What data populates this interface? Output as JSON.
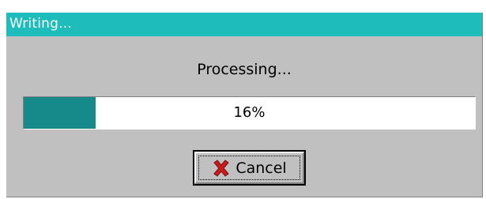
{
  "window": {
    "title": "Writing..."
  },
  "dialog": {
    "message": "Processing...",
    "progress": {
      "percent_label": "16%",
      "fraction": 0.16
    },
    "cancel_button": {
      "label": "Cancel",
      "icon": "red-x-icon"
    }
  },
  "colors": {
    "title_bar": "#1fbcbc",
    "dialog_bg": "#c0c0c0",
    "progress_fill": "#168a8a",
    "cancel_icon": "#cc1a1a"
  }
}
